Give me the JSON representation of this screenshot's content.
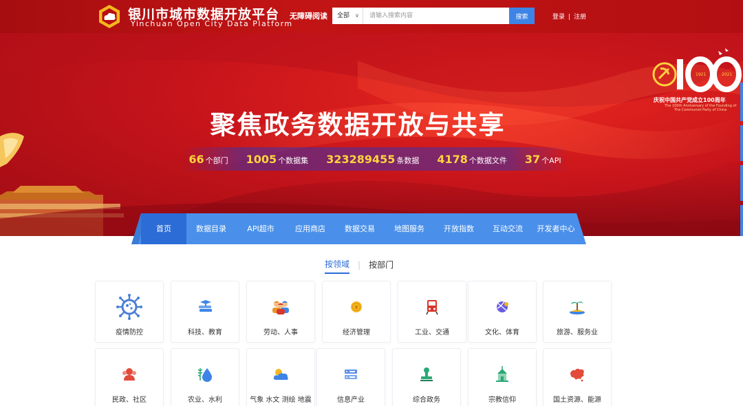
{
  "header": {
    "brand_cn": "银川市城市数据开放平台",
    "brand_en": "Yinchuan Open City Data Platform",
    "accessible_reading": "无障碍阅读",
    "search_scope": "全部",
    "search_placeholder": "请输入搜索内容",
    "search_button": "搜索",
    "login": "登录",
    "separator": "|",
    "register": "注册"
  },
  "banner": {
    "title": "聚焦政务数据开放与共享",
    "stats": [
      {
        "value": "66",
        "unit": "个部门"
      },
      {
        "value": "1005",
        "unit": "个数据集"
      },
      {
        "value": "323289455",
        "unit": "条数据"
      },
      {
        "value": "4178",
        "unit": "个数据文件"
      },
      {
        "value": "37",
        "unit": "个API"
      }
    ],
    "anniversary": {
      "number": "100",
      "year_start": "1921",
      "year_end": "2021",
      "title_cn": "庆祝中国共产党成立100周年",
      "title_en_1": "The 100th Anniversary of the Founding of",
      "title_en_2": "The Communist Party of China"
    }
  },
  "nav": {
    "items": [
      "首页",
      "数据目录",
      "API超市",
      "应用商店",
      "数据交易",
      "地图服务",
      "开放指数",
      "互动交流",
      "开发者中心"
    ],
    "active_index": 0
  },
  "filter_tabs": {
    "items": [
      "按领域",
      "按部门"
    ],
    "separator": "|",
    "active_index": 0
  },
  "categories": {
    "row1": [
      {
        "label": "疫情防控",
        "icon": "virus-icon",
        "color": "#4a7fd6"
      },
      {
        "label": "科技、教育",
        "icon": "books-icon",
        "color": "#3d84e6"
      },
      {
        "label": "劳动、人事",
        "icon": "workers-icon",
        "color": "#e8952c"
      },
      {
        "label": "经济管理",
        "icon": "coin-icon",
        "color": "#f5b81e"
      },
      {
        "label": "工业、交通",
        "icon": "train-icon",
        "color": "#d8362b"
      },
      {
        "label": "文化、体育",
        "icon": "ball-icon",
        "color": "#6a5be0"
      },
      {
        "label": "旅游、服务业",
        "icon": "island-icon",
        "color": "#2aa876"
      }
    ],
    "row2": [
      {
        "label": "民政、社区",
        "icon": "community-icon",
        "color": "#e24a3b"
      },
      {
        "label": "农业、水利",
        "icon": "water-drop-icon",
        "color": "#3d84e6"
      },
      {
        "label": "气象 水文 测绘 地震",
        "icon": "weather-icon",
        "color": "#f5b81e"
      },
      {
        "label": "信息产业",
        "icon": "server-icon",
        "color": "#5b8ee8"
      },
      {
        "label": "综合政务",
        "icon": "stamp-icon",
        "color": "#2aa876"
      },
      {
        "label": "宗教信仰",
        "icon": "temple-icon",
        "color": "#2aa876"
      },
      {
        "label": "国土资源、能源",
        "icon": "map-china-icon",
        "color": "#e24a3b"
      }
    ]
  }
}
